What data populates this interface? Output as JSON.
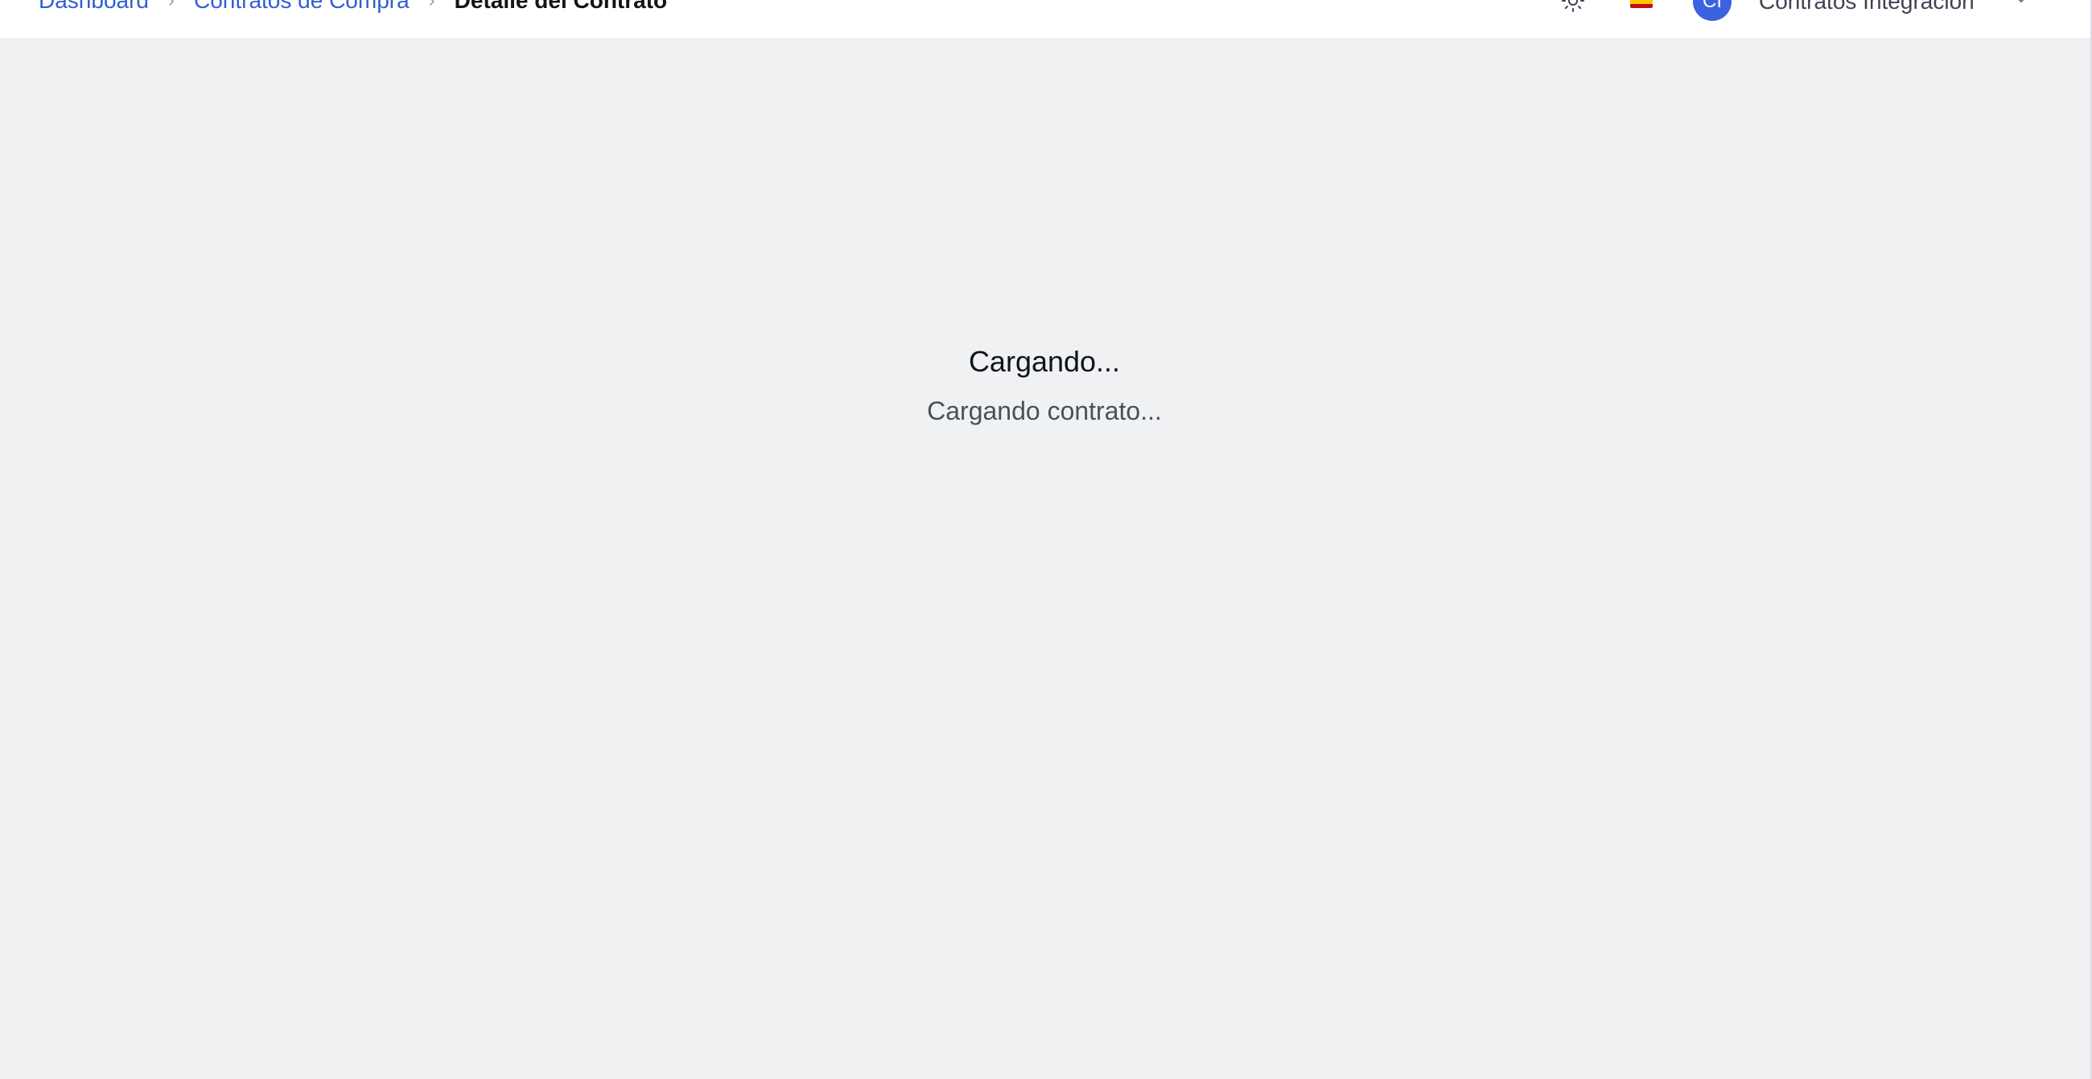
{
  "breadcrumb": {
    "items": [
      {
        "label": "Dashboard"
      },
      {
        "label": "Contratos de Compra"
      },
      {
        "label": "Detalle del Contrato"
      }
    ],
    "separator": "›"
  },
  "header": {
    "theme_icon": "sun-icon",
    "language_icon": "spain-flag-icon",
    "avatar_initials": "CI",
    "user_name": "Contratos Integración",
    "dropdown_icon": "chevron-down-icon",
    "avatar_color": "#3b63e0"
  },
  "loading": {
    "title": "Cargando...",
    "message": "Cargando contrato..."
  },
  "colors": {
    "link": "#2f5fd0",
    "background": "#f0f1f3",
    "header_bg": "#ffffff"
  }
}
